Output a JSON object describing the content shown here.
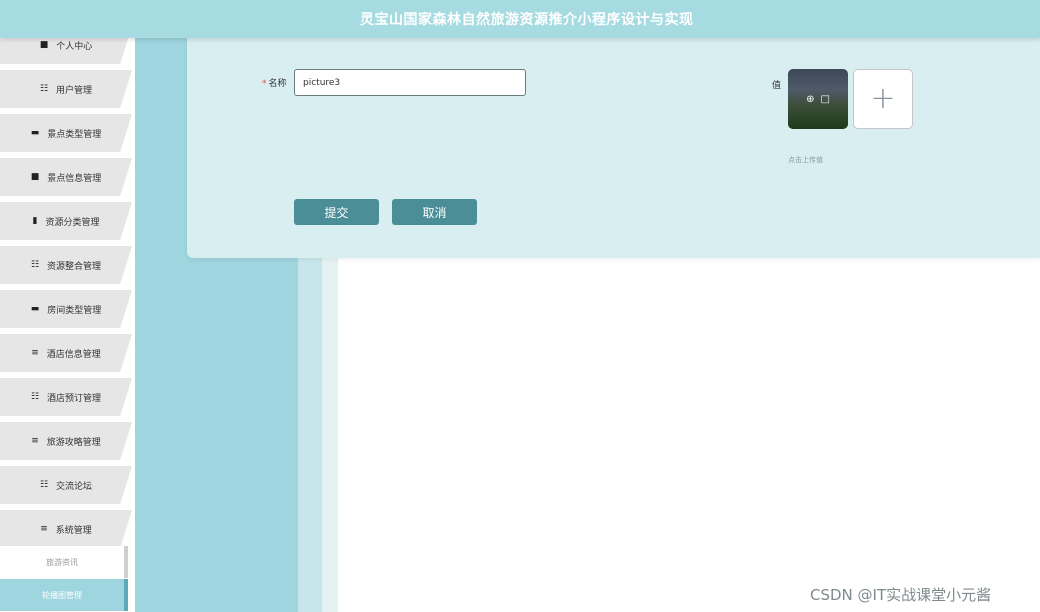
{
  "header": {
    "title": "灵宝山国家森林自然旅游资源推介小程序设计与实现"
  },
  "sidebar": {
    "items": [
      {
        "label": "个人中心",
        "icon": "person-icon",
        "glyph": "■"
      },
      {
        "label": "用户管理",
        "icon": "grid-icon",
        "glyph": "☷"
      },
      {
        "label": "景点类型管理",
        "icon": "laptop-icon",
        "glyph": "▬"
      },
      {
        "label": "景点信息管理",
        "icon": "briefcase-icon",
        "glyph": "■"
      },
      {
        "label": "资源分类管理",
        "icon": "clipboard-icon",
        "glyph": "▮"
      },
      {
        "label": "资源整合管理",
        "icon": "grid-icon",
        "glyph": "☷"
      },
      {
        "label": "房间类型管理",
        "icon": "monitor-icon",
        "glyph": "▬"
      },
      {
        "label": "酒店信息管理",
        "icon": "list-icon",
        "glyph": "≡"
      },
      {
        "label": "酒店预订管理",
        "icon": "apps-icon",
        "glyph": "☷"
      },
      {
        "label": "旅游攻略管理",
        "icon": "list-icon",
        "glyph": "≡"
      },
      {
        "label": "交流论坛",
        "icon": "grid-icon",
        "glyph": "☷"
      },
      {
        "label": "系统管理",
        "icon": "menu-icon",
        "glyph": "≡"
      }
    ],
    "sub_items": [
      {
        "label": "旅游资讯",
        "active": false
      },
      {
        "label": "轮播图管理",
        "active": true
      }
    ]
  },
  "form": {
    "name_label": "名称",
    "name_required_mark": "*",
    "name_value": "picture3",
    "value_label": "值",
    "upload_hint": "点击上传值",
    "upload_plus": "+",
    "submit_label": "提交",
    "cancel_label": "取消"
  },
  "watermark": "CSDN @IT实战课堂小元酱",
  "colors": {
    "header_bg": "#a5dbe1",
    "form_bg": "#d9eef1",
    "button": "#4b8e98",
    "active_menu": "#9fd5df"
  }
}
